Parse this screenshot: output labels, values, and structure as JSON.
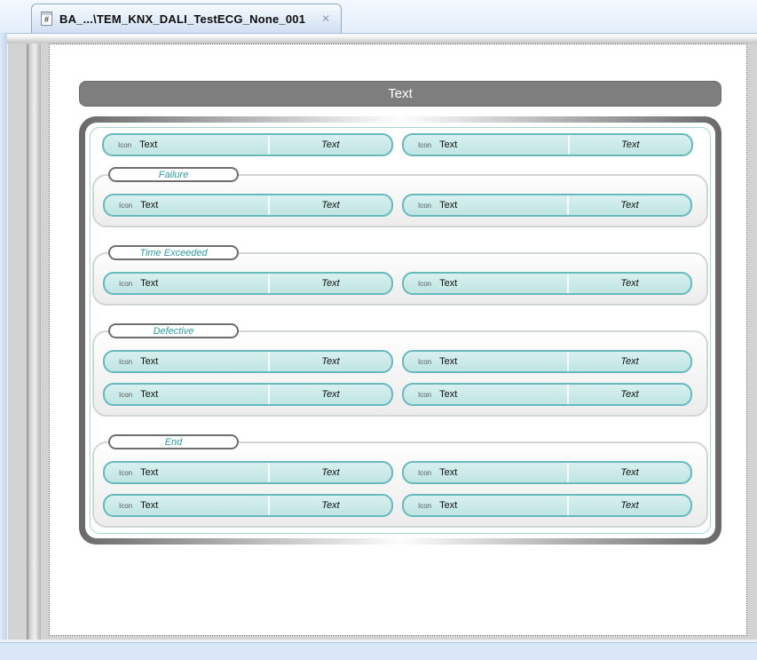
{
  "tab": {
    "title": "BA_...\\TEM_KNX_DALI_TestECG_None_001",
    "icon_glyph": "#",
    "close_glyph": "✕"
  },
  "design": {
    "header_label": "Text",
    "pill": {
      "icon_label": "Icon",
      "name_text": "Text",
      "value_text": "Text"
    },
    "groups": [
      {
        "label": "Failure"
      },
      {
        "label": "Time Exceeded"
      },
      {
        "label": "Defective"
      },
      {
        "label": "End"
      }
    ],
    "colors": {
      "header_fill": "#7e7e7e",
      "pill_fill": "#c8e9e8",
      "pill_border": "#67b9bc",
      "group_label_text": "#2f9ba5",
      "frame_gradient_dark": "#696969",
      "tab_fill": "#d6e4f5"
    }
  }
}
